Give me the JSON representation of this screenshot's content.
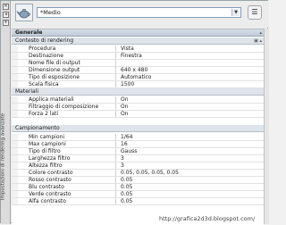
{
  "sidebar": {
    "title": "Impostazioni di rendering avanzate",
    "buttons": [
      "close",
      "auto-hide",
      "properties"
    ]
  },
  "preset": {
    "selected": "*Medio",
    "icon": "teapot-icon",
    "menu_icon": "menu-icon"
  },
  "sections": {
    "generale": {
      "label": "Generale",
      "contesto": {
        "label": "Contesto di rendering",
        "rows": [
          {
            "label": "Procedura",
            "value": "Vista"
          },
          {
            "label": "Destinazione",
            "value": "Finestra"
          },
          {
            "label": "Nome file di output",
            "value": ""
          },
          {
            "label": "Dimensione output",
            "value": "640 x 480"
          },
          {
            "label": "Tipo di esposizione",
            "value": "Automatico"
          },
          {
            "label": "Scala fisica",
            "value": "1500"
          }
        ]
      },
      "materiali": {
        "label": "Materiali",
        "rows": [
          {
            "label": "Applica materiali",
            "value": "On"
          },
          {
            "label": "Filtraggio di composizione",
            "value": "On"
          },
          {
            "label": "Forza 2 lati",
            "value": "On"
          }
        ]
      },
      "campionamento": {
        "label": "Campionamento",
        "rows": [
          {
            "label": "Min campioni",
            "value": "1/64"
          },
          {
            "label": "Max campioni",
            "value": "16"
          },
          {
            "label": "Tipo di filtro",
            "value": "Gauss"
          },
          {
            "label": "Larghezza filtro",
            "value": "3"
          },
          {
            "label": "Altezza filtro",
            "value": "3"
          },
          {
            "label": "Colore contrasto",
            "value": "0.05, 0.05, 0.05, 0.05"
          },
          {
            "label": "Rosso contrasto",
            "value": "0.05"
          },
          {
            "label": "Blu contrasto",
            "value": "0.05"
          },
          {
            "label": "Verde contrasto",
            "value": "0.05"
          },
          {
            "label": "Alfa contrasto",
            "value": "0.05"
          }
        ]
      }
    }
  },
  "watermark": "http://grafica2d3d.blogspot.com/"
}
